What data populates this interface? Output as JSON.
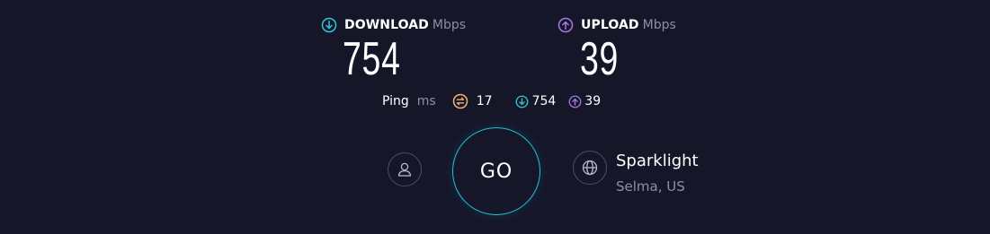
{
  "download": {
    "title": "DOWNLOAD",
    "unit": "Mbps",
    "value": "754",
    "icon": "download-arrow-icon",
    "color": "#2ec8d8"
  },
  "upload": {
    "title": "UPLOAD",
    "unit": "Mbps",
    "value": "39",
    "icon": "upload-arrow-icon",
    "color": "#a779e6"
  },
  "ping": {
    "label": "Ping",
    "unit": "ms",
    "idle_value": "17",
    "download_value": "754",
    "upload_value": "39",
    "idle_color": "#f3b36b"
  },
  "go_button": {
    "label": "GO",
    "color": "#20c3d8"
  },
  "server": {
    "name": "Sparklight",
    "location": "Selma, US"
  }
}
